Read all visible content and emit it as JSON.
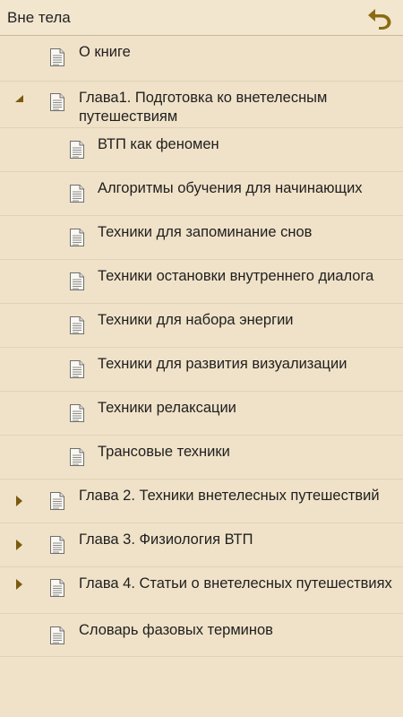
{
  "header": {
    "title": "Вне тела",
    "back_icon": "undo-icon"
  },
  "colors": {
    "background": "#F0E2C8",
    "accent": "#8B6B12",
    "divider": "#E0D2B6"
  },
  "items": [
    {
      "label": "О книге",
      "level": 0,
      "expander": "none"
    },
    {
      "label": "Глава1. Подготовка ко внетелесным путешествиям",
      "level": 0,
      "expander": "expanded"
    },
    {
      "label": "ВТП как феномен",
      "level": 1,
      "expander": "none"
    },
    {
      "label": "Алгоритмы обучения для начинающих",
      "level": 1,
      "expander": "none"
    },
    {
      "label": "Техники для запоминание снов",
      "level": 1,
      "expander": "none"
    },
    {
      "label": "Техники остановки внутреннего диалога",
      "level": 1,
      "expander": "none"
    },
    {
      "label": "Техники для набора энергии",
      "level": 1,
      "expander": "none"
    },
    {
      "label": "Техники для развития визуализации",
      "level": 1,
      "expander": "none"
    },
    {
      "label": "Техники релаксации",
      "level": 1,
      "expander": "none"
    },
    {
      "label": "Трансовые техники",
      "level": 1,
      "expander": "none"
    },
    {
      "label": "Глава 2. Техники внетелесных путешествий",
      "level": 0,
      "expander": "collapsed"
    },
    {
      "label": "Глава 3. Физиология ВТП",
      "level": 0,
      "expander": "collapsed"
    },
    {
      "label": "Глава 4. Статьи о внетелесных путешествиях",
      "level": 0,
      "expander": "collapsed"
    },
    {
      "label": "Словарь фазовых терминов",
      "level": 0,
      "expander": "none"
    }
  ]
}
